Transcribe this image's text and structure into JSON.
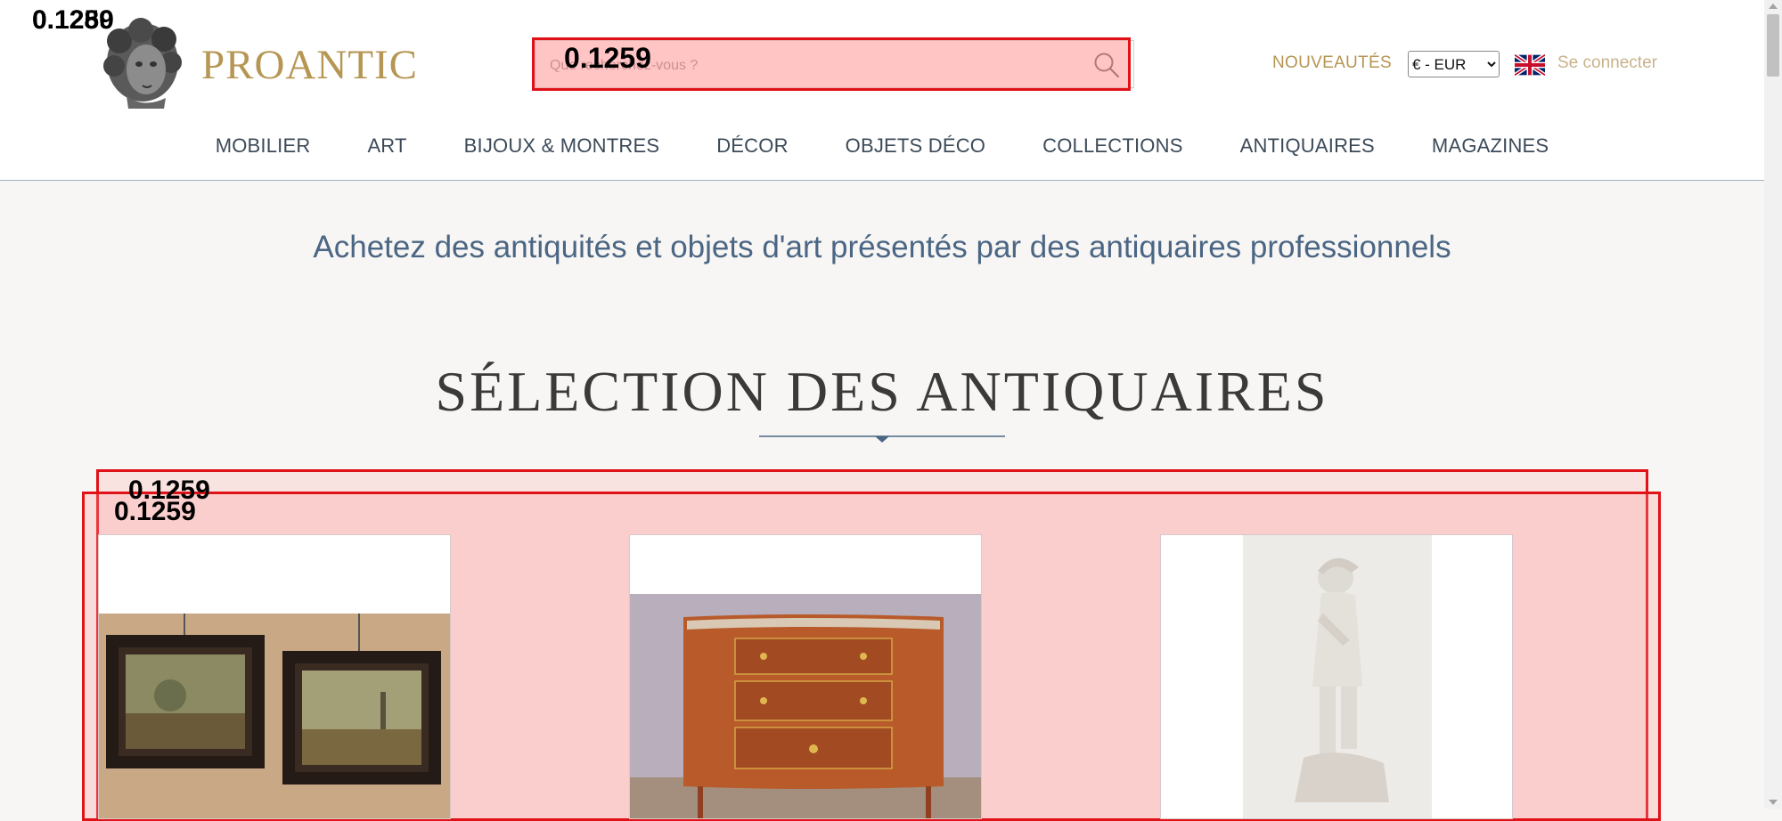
{
  "header": {
    "logo_text": "PROANTIC",
    "search": {
      "placeholder": "Que recherchez-vous ?",
      "value": ""
    },
    "nouveautes_label": "NOUVEAUTÉS",
    "currency": {
      "selected": "€ - EUR",
      "options": [
        "€ - EUR"
      ]
    },
    "language_flag": "uk-flag-icon",
    "login_label": "Se connecter"
  },
  "nav": {
    "items": [
      {
        "label": "MOBILIER"
      },
      {
        "label": "ART"
      },
      {
        "label": "BIJOUX & MONTRES"
      },
      {
        "label": "DÉCOR"
      },
      {
        "label": "OBJETS DÉCO"
      },
      {
        "label": "COLLECTIONS"
      },
      {
        "label": "ANTIQUAIRES"
      },
      {
        "label": "MAGAZINES"
      }
    ]
  },
  "main": {
    "tagline": "Achetez des antiquités et objets d'art présentés par des antiquaires professionnels",
    "section_title": "SÉLECTION DES ANTIQUAIRES",
    "cards": [
      {
        "image": "framed-paintings-pair"
      },
      {
        "image": "demi-lune-commode"
      },
      {
        "image": "white-figurine-statue"
      }
    ]
  },
  "overlays": {
    "logo_label": "0.1259",
    "logo_label_2": "0.1280",
    "search_label": "0.1259",
    "carousel_label": "0.1259",
    "carousel_label_2": "0.1259"
  },
  "colors": {
    "brand_gold": "#b59653",
    "nav_text": "#3c4a58",
    "tagline_blue": "#4b6684",
    "highlight_red": "#e01218"
  }
}
